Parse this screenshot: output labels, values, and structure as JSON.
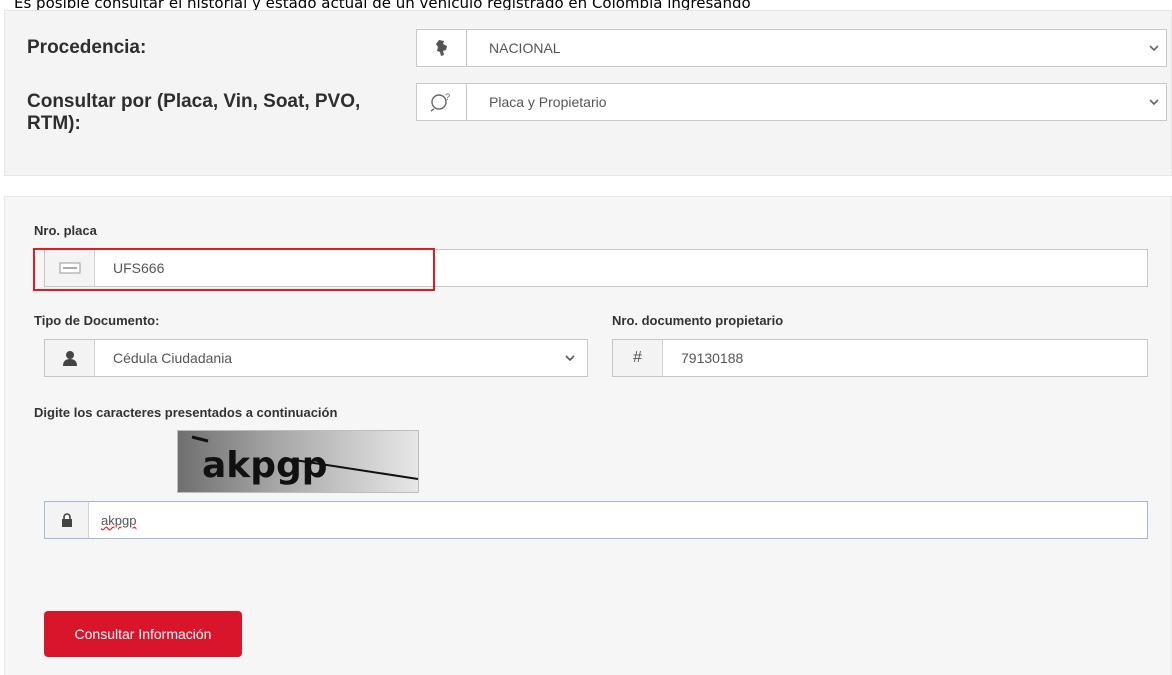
{
  "caption": "Es posible consultar el historial y estado actual de un vehículo registrado en Colombia ingresando",
  "top_panel": {
    "procedencia_label": "Procedencia:",
    "procedencia_value": "NACIONAL",
    "consulta_label": "Consultar por (Placa, Vin, Soat, PVO, RTM):",
    "consulta_value": "Placa y Propietario"
  },
  "form": {
    "placa_label": "Nro. placa",
    "placa_value": "UFS666",
    "tipo_doc_label": "Tipo de Documento:",
    "tipo_doc_value": "Cédula Ciudadania",
    "nro_doc_label": "Nro. documento propietario",
    "nro_doc_value": "79130188",
    "captcha_label": "Digite los caracteres presentados a continuación",
    "captcha_text": "akpgp",
    "captcha_input_value": "akpgp",
    "submit_label": "Consultar Información"
  },
  "colors": {
    "accent_red": "#d8152b",
    "highlight_border": "#e01b22",
    "focus_border": "#7fa7d6"
  },
  "icons": {
    "procedencia": "colombia-map-icon",
    "consulta": "search-question-icon",
    "placa": "license-plate-icon",
    "tipo_doc": "user-icon",
    "nro_doc": "hash-icon",
    "captcha": "lock-icon"
  }
}
